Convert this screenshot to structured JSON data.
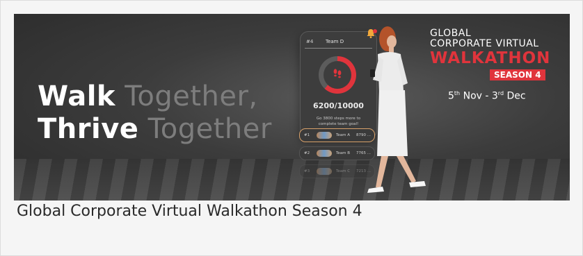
{
  "banner": {
    "headline": {
      "line1_strong": "Walk",
      "line1_dim": " Together,",
      "line2_strong": "Thrive",
      "line2_dim": " Together"
    },
    "stats_card": {
      "rank": "#4",
      "team": "Team D",
      "steps": "6200/10000",
      "progress_fraction": 0.62,
      "note": "Go 3800 steps more to complete team goal!"
    },
    "leaderboard": [
      {
        "rank": "#1",
        "team": "Team A",
        "score": "8790 ..."
      },
      {
        "rank": "#2",
        "team": "Team B",
        "score": "7765 ..."
      },
      {
        "rank": "#3",
        "team": "Team C",
        "score": "7213 ..."
      }
    ],
    "event": {
      "line1": "GLOBAL",
      "line2": "CORPORATE VIRTUAL",
      "line3": "WALKATHON",
      "season": "SEASON 4",
      "date_start_day": "5",
      "date_start_suffix": "th",
      "date_start_month": " Nov - ",
      "date_end_day": "3",
      "date_end_suffix": "rd",
      "date_end_month": " Dec"
    },
    "colors": {
      "accent": "#e0343c",
      "background": "#3c3c3c"
    }
  },
  "caption": "Global Corporate Virtual Walkathon Season 4"
}
